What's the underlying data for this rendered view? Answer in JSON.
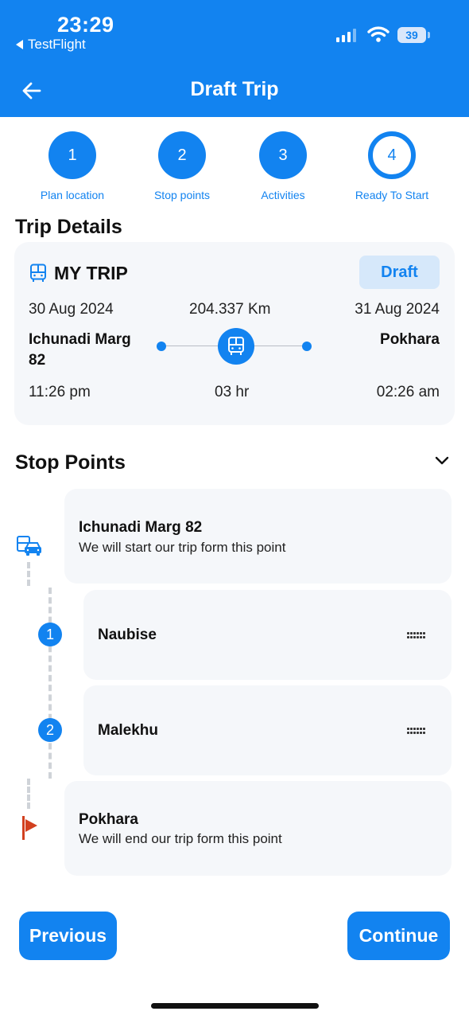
{
  "status_bar": {
    "time": "23:29",
    "back_app": "TestFlight",
    "battery": "39"
  },
  "header": {
    "title": "Draft Trip"
  },
  "steps": [
    {
      "number": "1",
      "label": "Plan location",
      "state": "complete"
    },
    {
      "number": "2",
      "label": "Stop points",
      "state": "complete"
    },
    {
      "number": "3",
      "label": "Activities",
      "state": "complete"
    },
    {
      "number": "4",
      "label": "Ready To Start",
      "state": "current"
    }
  ],
  "trip_details": {
    "section_title": "Trip Details",
    "trip_name": "MY TRIP",
    "status": "Draft",
    "start_date": "30 Aug 2024",
    "distance": "204.337 Km",
    "end_date": "31 Aug 2024",
    "origin_line1": "Ichunadi Marg",
    "origin_line2": "82",
    "destination": "Pokhara",
    "start_time": "11:26 pm",
    "duration": "03 hr",
    "end_time": "02:26 am"
  },
  "stop_points": {
    "section_title": "Stop Points",
    "start": {
      "name": "Ichunadi Marg 82",
      "description": "We will start our trip form this point"
    },
    "stops": [
      {
        "number": "1",
        "name": "Naubise"
      },
      {
        "number": "2",
        "name": "Malekhu"
      }
    ],
    "end": {
      "name": "Pokhara",
      "description": "We will end our trip form this point"
    }
  },
  "actions": {
    "previous": "Previous",
    "continue": "Continue"
  },
  "colors": {
    "primary": "#1283F0",
    "card_bg": "#F5F7FA",
    "badge_bg": "#D6E8FA",
    "flag": "#D2401F"
  }
}
